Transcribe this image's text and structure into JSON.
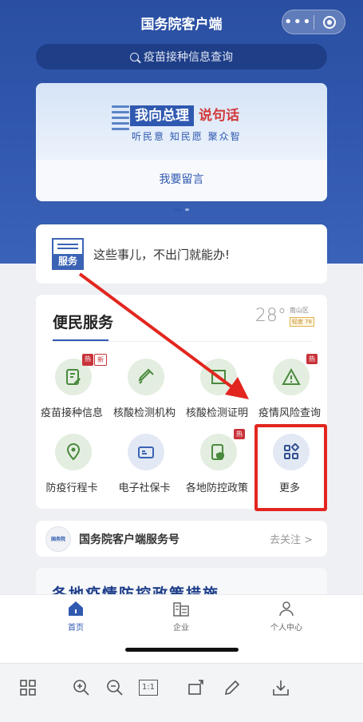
{
  "nav": {
    "title": "国务院客户端",
    "more_label": "•••"
  },
  "search": {
    "placeholder": "疫苗接种信息查询"
  },
  "banner": {
    "title_main": "我向总理",
    "title_accent": "说句话",
    "subtitle": "听民意 知民愿 聚众智",
    "action": "我要留言"
  },
  "service_card": {
    "icon_label": "服务",
    "text": "这些事儿，不出门就能办!"
  },
  "grid": {
    "title": "便民服务",
    "weather": {
      "temp": "28°",
      "area": "南山区",
      "air": "轻度 78"
    },
    "items": [
      {
        "label": "疫苗接种信息",
        "badges": [
          "热",
          "新"
        ],
        "icon": "vaccine-record-icon",
        "tone": "green"
      },
      {
        "label": "核酸检测机构",
        "badges": [],
        "icon": "syringe-icon",
        "tone": "green"
      },
      {
        "label": "核酸检测证明",
        "badges": [],
        "icon": "certificate-icon",
        "tone": "green"
      },
      {
        "label": "疫情风险查询",
        "badges": [
          "热"
        ],
        "icon": "warning-icon",
        "tone": "green"
      },
      {
        "label": "防疫行程卡",
        "badges": [],
        "icon": "location-pin-icon",
        "tone": "green"
      },
      {
        "label": "电子社保卡",
        "badges": [],
        "icon": "id-card-icon",
        "tone": "blue"
      },
      {
        "label": "各地防控政策",
        "badges": [
          "热"
        ],
        "icon": "shield-doc-icon",
        "tone": "green"
      },
      {
        "label": "更多",
        "badges": [],
        "icon": "grid-more-icon",
        "tone": "blue"
      }
    ]
  },
  "follow": {
    "logo_text": "国务院",
    "title": "国务院客户端服务号",
    "action": "去关注 >"
  },
  "peek": {
    "text": "各地疫情防控政策措施"
  },
  "tabs": [
    {
      "label": "首页",
      "icon": "home-icon"
    },
    {
      "label": "企业",
      "icon": "building-icon"
    },
    {
      "label": "个人中心",
      "icon": "person-icon"
    }
  ],
  "viewer_toolbar": {
    "icons": [
      "grid-view-icon",
      "zoom-in-icon",
      "zoom-out-icon",
      "actual-size-icon",
      "rotate-icon",
      "edit-icon",
      "download-icon"
    ],
    "actual_size_label": "1:1"
  },
  "colors": {
    "brand_blue": "#2f59b0",
    "hot_red": "#c8333a",
    "highlight_red": "#e2261f",
    "tile_green": "#e3eee0"
  }
}
